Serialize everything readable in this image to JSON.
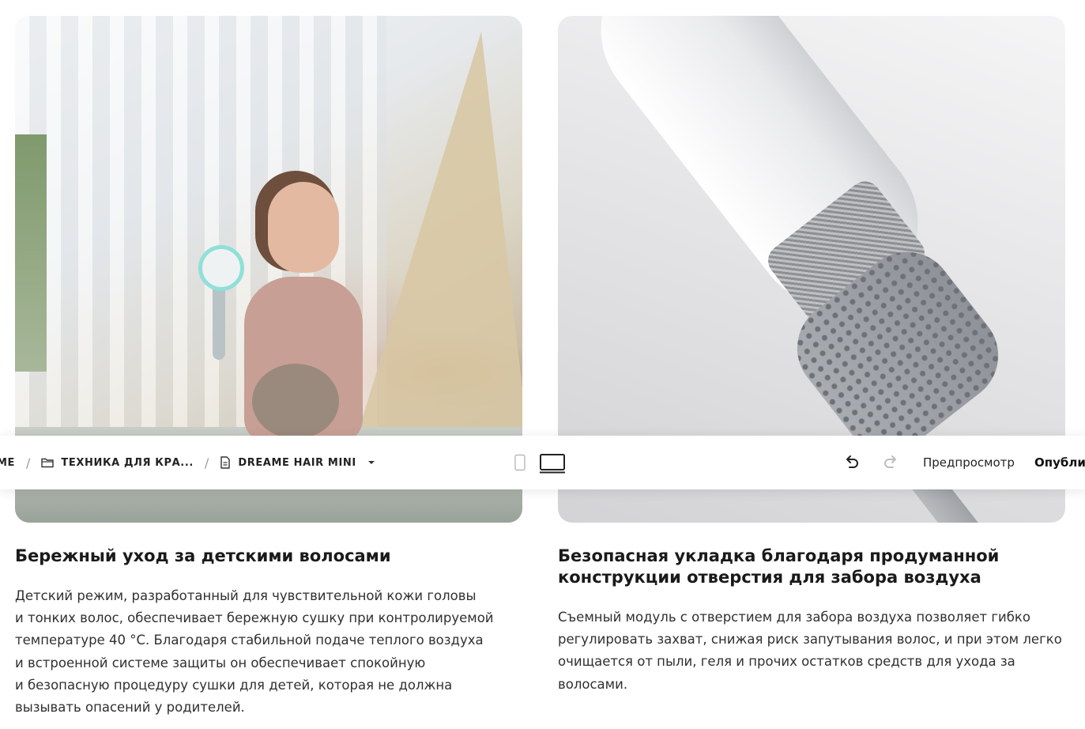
{
  "left_card": {
    "title": "Бережный уход за детскими волосами",
    "body": [
      "Детский режим, разработанный для чувствительной кожи головы",
      "и тонких волос, обеспечивает бережную сушку при контролируемой",
      "температуре 40 °C. Благодаря стабильной подаче теплого воздуха",
      "и встроенной системе защиты он обеспечивает спокойную",
      "и безопасную процедуру сушки для детей, которая не должна",
      "вызывать опасений у родителей."
    ]
  },
  "right_card": {
    "title": [
      "Безопасная укладка благодаря продуманной",
      "конструкции отверстия для забора воздуха"
    ],
    "body": [
      "Съемный модуль с отверстием для забора воздуха позволяет гибко",
      "регулировать захват, снижая риск запутывания волос, и при этом легко",
      "очищается от пыли, геля и прочих остатков средств для ухода за",
      "волосами."
    ]
  },
  "toolbar": {
    "breadcrumb": {
      "first_fragment": "ME",
      "separator": "/",
      "folder_label": "ТЕХНИКА ДЛЯ КРА...",
      "page_label": "DREAME HAIR MINI"
    },
    "preview_label": "Предпросмотр",
    "publish_label": "Опубли"
  },
  "icons": {
    "folder": "folder-icon",
    "page": "page-icon",
    "dropdown": "caret-down-icon",
    "mobile": "mobile-device-icon",
    "desktop": "desktop-device-icon",
    "undo": "undo-icon",
    "redo": "redo-icon"
  },
  "colors": {
    "text": "#1c1c1c",
    "muted_icon": "#b5b5b5",
    "toolbar_bg": "#ffffff"
  }
}
